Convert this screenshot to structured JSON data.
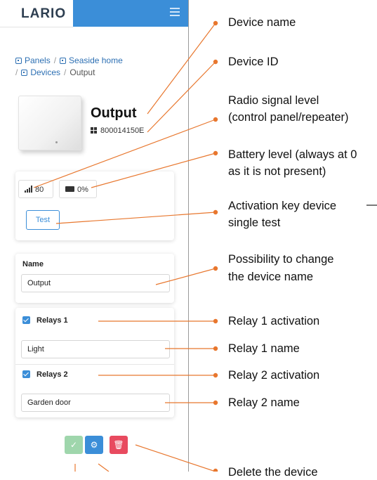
{
  "app": {
    "logo": "LARIO"
  },
  "breadcrumb": {
    "panels": "Panels",
    "home": "Seaside home",
    "devices": "Devices",
    "current": "Output",
    "separator": "/"
  },
  "device": {
    "name": "Output",
    "id": "800014150E"
  },
  "status": {
    "signal": "80",
    "battery": "0%"
  },
  "test_button": "Test",
  "name_card": {
    "label": "Name",
    "value": "Output"
  },
  "relays": [
    {
      "label": "Relays 1",
      "checked": true,
      "name": "Light"
    },
    {
      "label": "Relays 2",
      "checked": true,
      "name": "Garden door"
    }
  ],
  "actions": {
    "confirm": "✓",
    "settings": "⚙",
    "delete": "🗑"
  },
  "callouts": {
    "device_name": "Device name",
    "device_id": "Device ID",
    "radio_1": "Radio signal level",
    "radio_2": "(control panel/repeater)",
    "battery_1": "Battery level (always at 0",
    "battery_2": "as it is not present)",
    "test_1": "Activation key device",
    "test_2": "single test",
    "rename_1": "Possibility to change",
    "rename_2": "the device name",
    "relay1_act": "Relay 1 activation",
    "relay1_name": "Relay 1 name",
    "relay2_act": "Relay 2 activation",
    "relay2_name": "Relay 2 name",
    "delete": "Delete the device"
  },
  "colors": {
    "accent": "#3b8ed8",
    "leader": "#e8772e",
    "confirm": "#9fd6ac",
    "delete": "#e84a5f"
  }
}
